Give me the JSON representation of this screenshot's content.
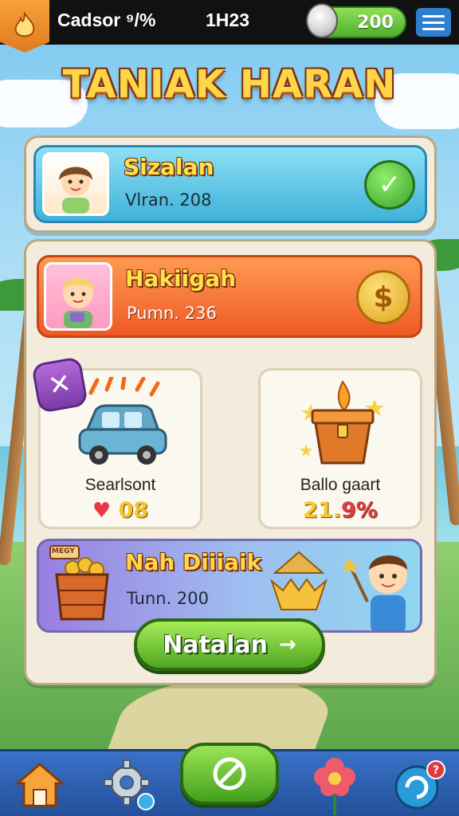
{
  "topbar": {
    "app_name": "Cadsor ⁹/%",
    "time": "1H23",
    "coins": "200"
  },
  "headline": "TANIAK HARAN",
  "cards": {
    "first": {
      "title": "Sizalan",
      "subtitle": "Vlran. 208"
    },
    "second": {
      "title": "Hakiigah",
      "subtitle": "Pumn. 236"
    },
    "third": {
      "title": "Nah Diiiaik",
      "subtitle": "Tunn. 200",
      "crate_sign": "MEGY"
    }
  },
  "tiles": {
    "left": {
      "name": "Searlsont",
      "value": "08"
    },
    "right": {
      "name": "Ballo gaart",
      "value": "21.",
      "value_pct": "9%"
    }
  },
  "cta": {
    "label": "Natalan",
    "arrow": "→"
  },
  "icons": {
    "app_badge": "flame-icon",
    "coin_search": "magnifier-coin-icon",
    "menu": "hamburger-icon",
    "check": "checkmark-icon",
    "dollar": "dollar-coin-icon",
    "close": "close-icon",
    "heart": "heart-icon",
    "car": "car-icon",
    "chest": "treasure-chest-icon",
    "nav": [
      "home-icon",
      "settings-icon",
      "cancel-icon",
      "flower-icon",
      "refresh-icon"
    ]
  },
  "colors": {
    "accent_green": "#4ea61f",
    "accent_orange": "#ee5a24",
    "accent_blue": "#3fb2d9",
    "headline_gold": "#ffd54a"
  }
}
